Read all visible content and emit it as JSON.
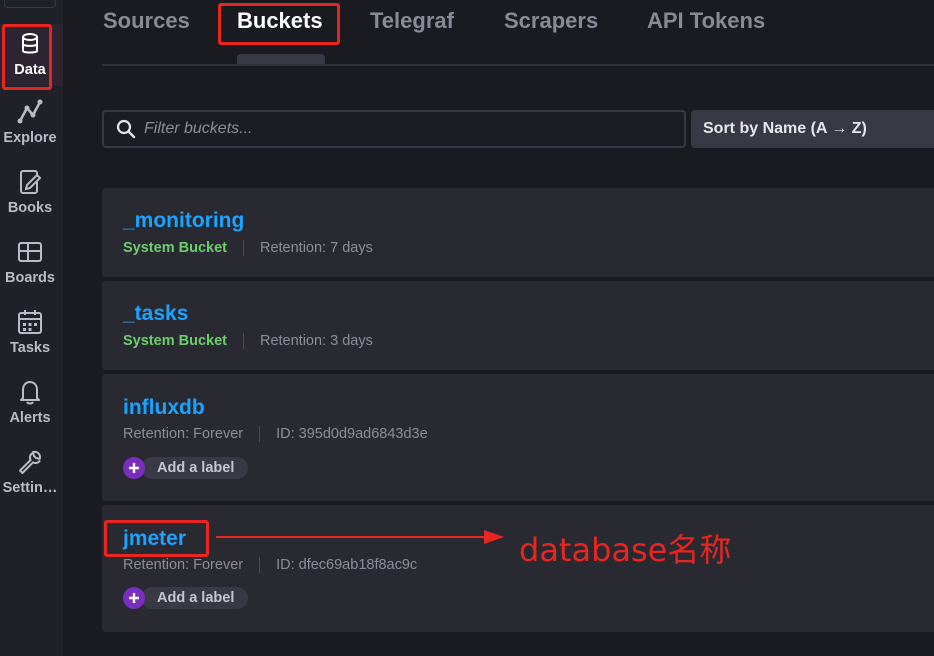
{
  "sidebar": {
    "items": [
      {
        "label": "Data",
        "icon": "database-icon",
        "active": true
      },
      {
        "label": "Explore",
        "icon": "graph-icon",
        "active": false
      },
      {
        "label": "Books",
        "icon": "notebook-icon",
        "active": false
      },
      {
        "label": "Boards",
        "icon": "dashboard-icon",
        "active": false
      },
      {
        "label": "Tasks",
        "icon": "calendar-icon",
        "active": false
      },
      {
        "label": "Alerts",
        "icon": "bell-icon",
        "active": false
      },
      {
        "label": "Settin…",
        "icon": "wrench-icon",
        "active": false
      }
    ]
  },
  "tabs": [
    {
      "label": "Sources",
      "active": false
    },
    {
      "label": "Buckets",
      "active": true
    },
    {
      "label": "Telegraf",
      "active": false
    },
    {
      "label": "Scrapers",
      "active": false
    },
    {
      "label": "API Tokens",
      "active": false
    }
  ],
  "filter": {
    "placeholder": "Filter buckets...",
    "value": ""
  },
  "sort": {
    "label": "Sort by Name (A → Z)"
  },
  "buckets": [
    {
      "name": "_monitoring",
      "tag": "System Bucket",
      "retention": "Retention: 7 days"
    },
    {
      "name": "_tasks",
      "tag": "System Bucket",
      "retention": "Retention: 3 days"
    },
    {
      "name": "influxdb",
      "retention": "Retention: Forever",
      "id": "ID: 395d0d9ad6843d3e",
      "add_label": "Add a label"
    },
    {
      "name": "jmeter",
      "retention": "Retention: Forever",
      "id": "ID: dfec69ab18f8ac9c",
      "add_label": "Add a label"
    }
  ],
  "annotation": {
    "text": "database名称"
  },
  "colors": {
    "accent_blue": "#1aa3ff",
    "system_green": "#6bcf6b",
    "annotation_red": "#e8251f",
    "label_purple": "#7a2ec0"
  }
}
